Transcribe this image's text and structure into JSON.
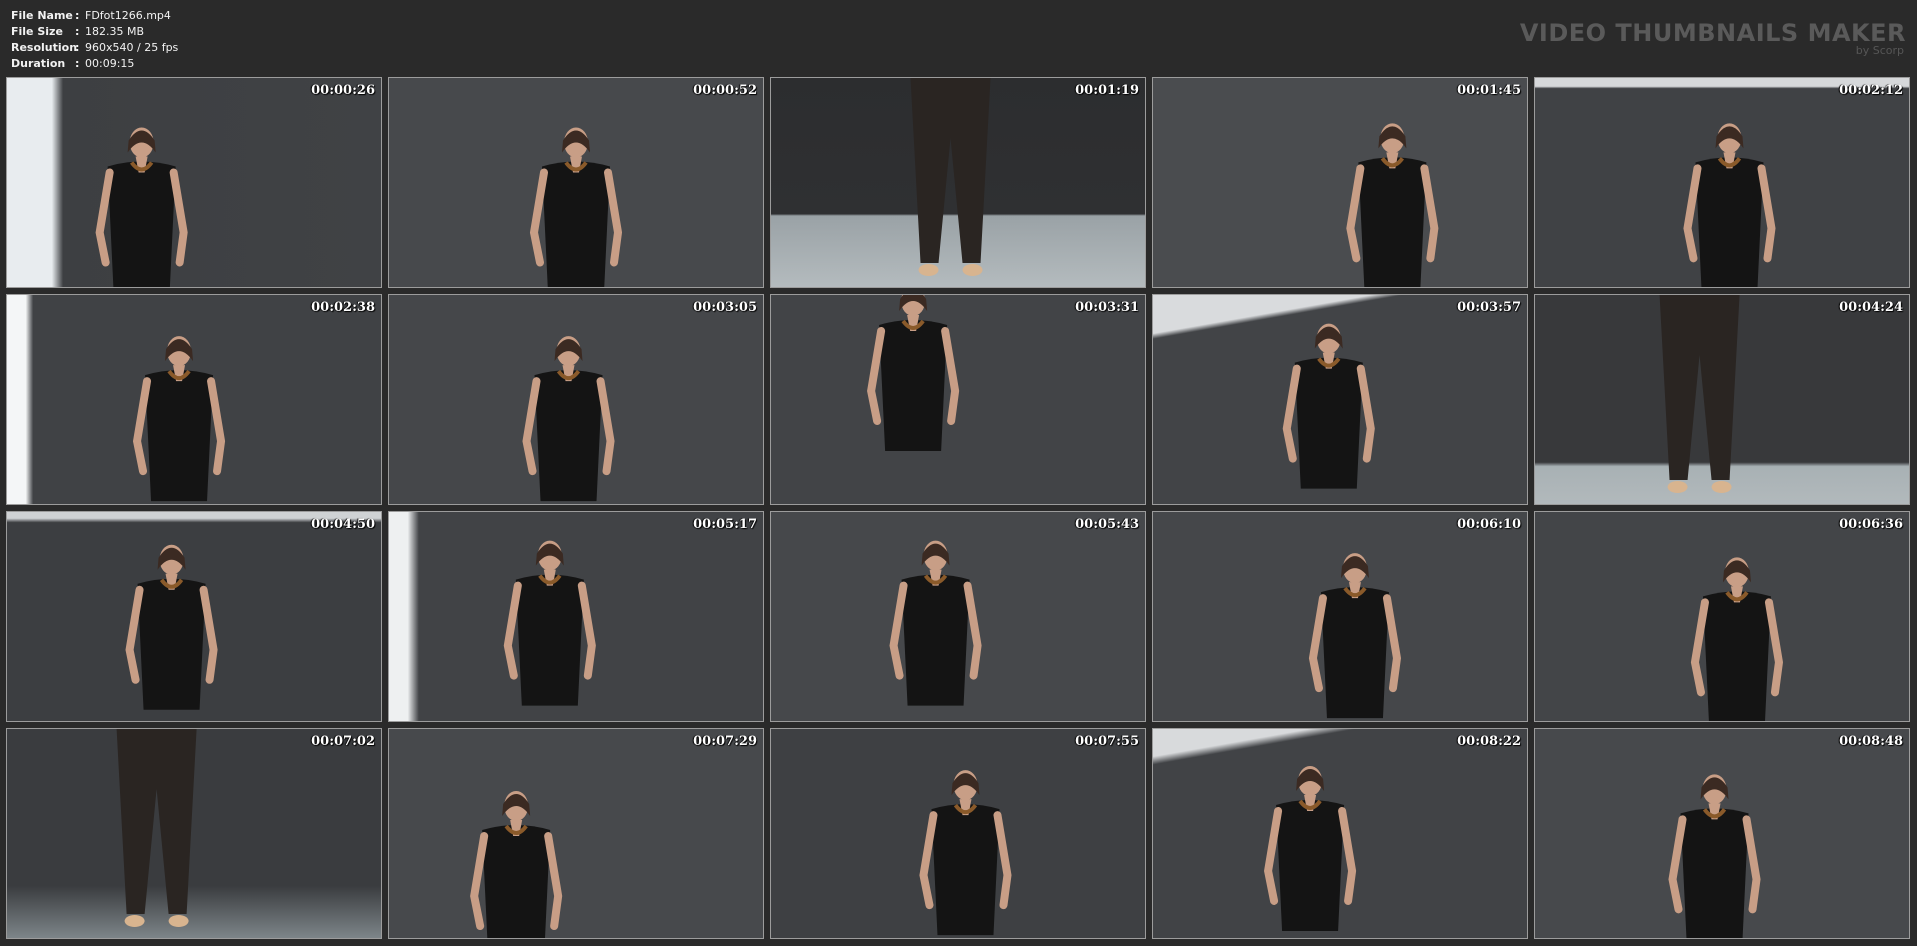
{
  "file_info": {
    "name_label": "File Name",
    "name_value": "FDfot1266.mp4",
    "size_label": "File Size",
    "size_value": "182.35 MB",
    "resolution_label": "Resolution",
    "resolution_value": "960x540 / 25 fps",
    "duration_label": "Duration",
    "duration_value": "00:09:15",
    "separator": ":"
  },
  "brand": {
    "title": "VIDEO THUMBNAILS MAKER",
    "subtitle": "by Scorp"
  },
  "thumbnails": [
    {
      "time": "00:00:26"
    },
    {
      "time": "00:00:52"
    },
    {
      "time": "00:01:19"
    },
    {
      "time": "00:01:45"
    },
    {
      "time": "00:02:12"
    },
    {
      "time": "00:02:38"
    },
    {
      "time": "00:03:05"
    },
    {
      "time": "00:03:31"
    },
    {
      "time": "00:03:57"
    },
    {
      "time": "00:04:24"
    },
    {
      "time": "00:04:50"
    },
    {
      "time": "00:05:17"
    },
    {
      "time": "00:05:43"
    },
    {
      "time": "00:06:10"
    },
    {
      "time": "00:06:36"
    },
    {
      "time": "00:07:02"
    },
    {
      "time": "00:07:29"
    },
    {
      "time": "00:07:55"
    },
    {
      "time": "00:08:22"
    },
    {
      "time": "00:08:48"
    }
  ]
}
